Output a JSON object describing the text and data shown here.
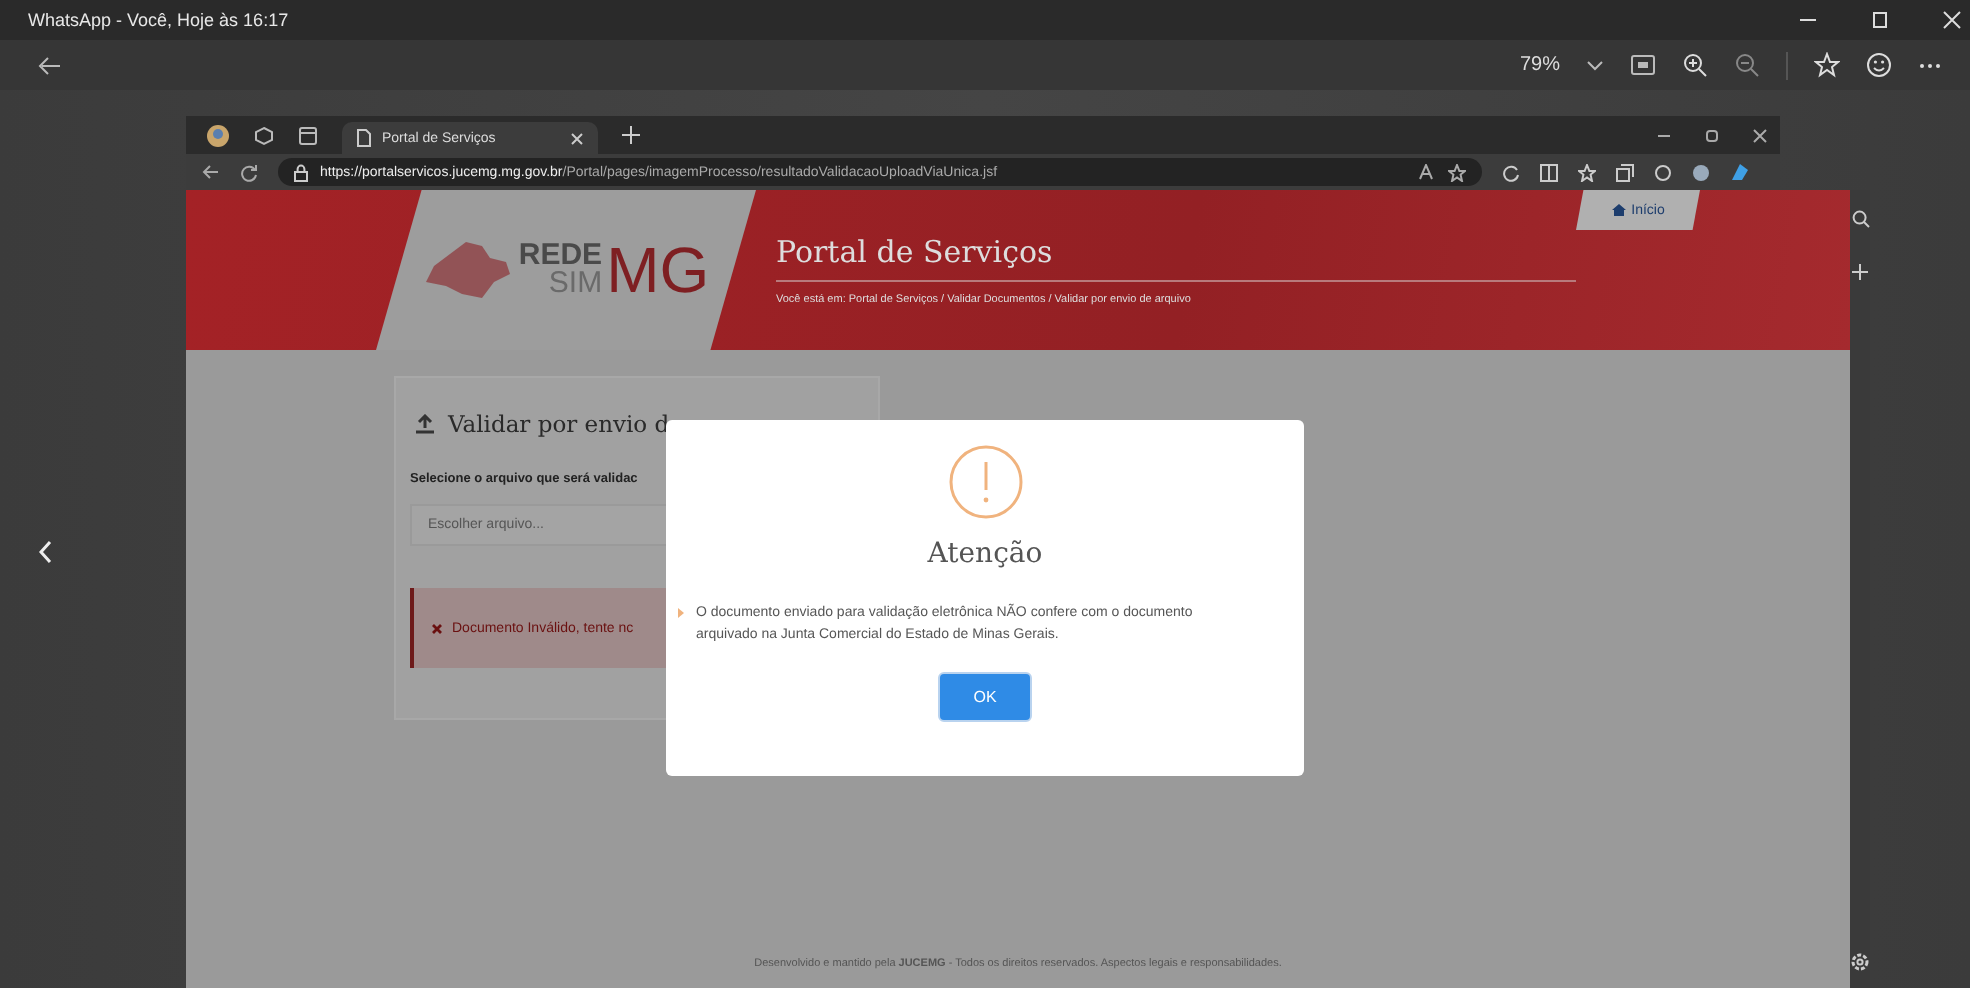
{
  "window": {
    "title": "WhatsApp - Você, Hoje às 16:17"
  },
  "viewer": {
    "zoom": "79%"
  },
  "browser": {
    "tab_title": "Portal de Serviços",
    "url_host": "https://portalservicos.jucemg.mg.gov.br",
    "url_path": "/Portal/pages/imagemProcesso/resultadoValidacaoUploadViaUnica.jsf"
  },
  "header": {
    "logo_top": "REDE",
    "logo_bottom": "SIM",
    "logo_big": "MG",
    "title": "Portal de Serviços",
    "breadcrumb": "Você está em: Portal de Serviços / Validar Documentos / Validar por envio de arquivo",
    "home_link": "Início"
  },
  "card": {
    "title": "Validar por envio d",
    "label": "Selecione o arquivo que será validac",
    "file_placeholder": "Escolher arquivo...",
    "error": "Documento Inválido, tente nc"
  },
  "modal": {
    "title": "Atenção",
    "message": "O documento enviado para validação eletrônica NÃO confere com o documento arquivado na Junta Comercial do Estado de Minas Gerais.",
    "button": "OK"
  },
  "footer": "Desenvolvido e mantido pela **JUCEMG** - Todos os direitos reservados. Aspectos legais e responsabilidades."
}
